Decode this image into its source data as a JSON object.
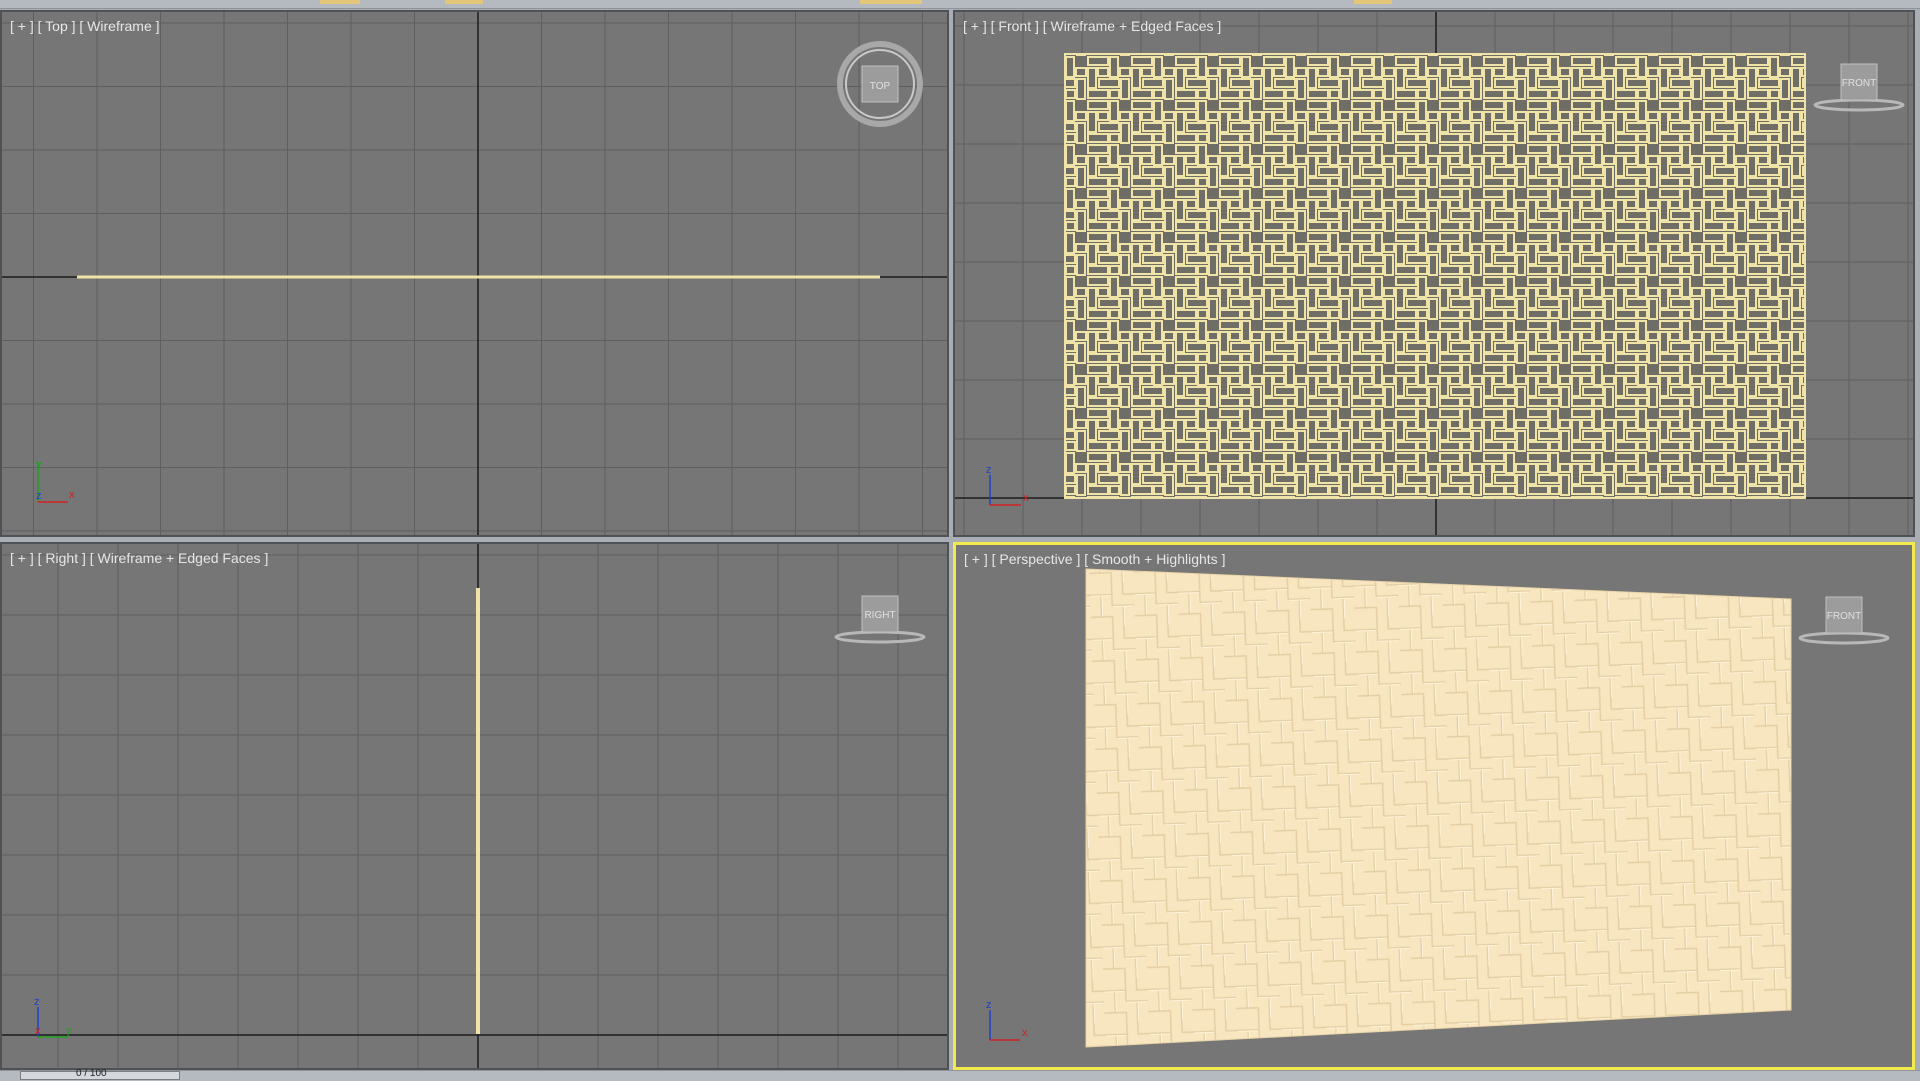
{
  "viewports": {
    "top": {
      "label_plus": "[ + ]",
      "label_view": "[ Top ]",
      "label_mode": "[ Wireframe ]",
      "nav_label": "TOP",
      "axes": {
        "a": "y",
        "b": "z",
        "c": "x"
      }
    },
    "front": {
      "label_plus": "[ + ]",
      "label_view": "[ Front ]",
      "label_mode": "[ Wireframe + Edged Faces ]",
      "nav_label": "FRONT",
      "axes": {
        "a": "z",
        "c": "x"
      }
    },
    "right": {
      "label_plus": "[ + ]",
      "label_view": "[ Right ]",
      "label_mode": "[ Wireframe + Edged Faces ]",
      "nav_label": "RIGHT",
      "axes": {
        "a": "z",
        "b": "x",
        "c": "y"
      }
    },
    "perspective": {
      "label_plus": "[ + ]",
      "label_view": "[ Perspective ]",
      "label_mode": "[ Smooth + Highlights ]",
      "nav_label": "FRONT",
      "axes": {
        "a": "z",
        "c": "x"
      }
    }
  },
  "time_slider": {
    "label": "0 / 100"
  },
  "colors": {
    "viewport_bg": "#767676",
    "grid_line": "#5f5f5f",
    "home_grid_line": "#1c1c1c",
    "object_wire": "#efe3a8",
    "object_face": "#f8e6c0",
    "active_border": "#f2ea4a",
    "axis_x": "#d22020",
    "axis_y": "#20a020",
    "axis_z": "#2040d0"
  }
}
